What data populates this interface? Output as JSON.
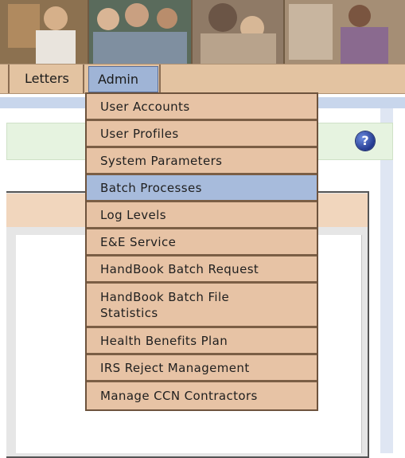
{
  "nav": {
    "letters": "Letters",
    "admin": "Admin"
  },
  "help_icon": "?",
  "admin_menu": {
    "items": [
      {
        "label": "User Accounts",
        "highlighted": false
      },
      {
        "label": "User Profiles",
        "highlighted": false
      },
      {
        "label": "System Parameters",
        "highlighted": false
      },
      {
        "label": "Batch Processes",
        "highlighted": true
      },
      {
        "label": "Log Levels",
        "highlighted": false
      },
      {
        "label": "E&E Service",
        "highlighted": false
      },
      {
        "label": "HandBook Batch Request",
        "highlighted": false
      },
      {
        "label": "HandBook Batch File\nStatistics",
        "highlighted": false
      },
      {
        "label": "Health Benefits Plan",
        "highlighted": false
      },
      {
        "label": "IRS Reject Management",
        "highlighted": false
      },
      {
        "label": "Manage CCN Contractors",
        "highlighted": false
      }
    ]
  },
  "colors": {
    "nav_bg": "#e3c3a1",
    "menu_item_bg": "#e7c3a5",
    "menu_highlight": "#a7bbdc",
    "admin_active": "#9fb4d6"
  }
}
